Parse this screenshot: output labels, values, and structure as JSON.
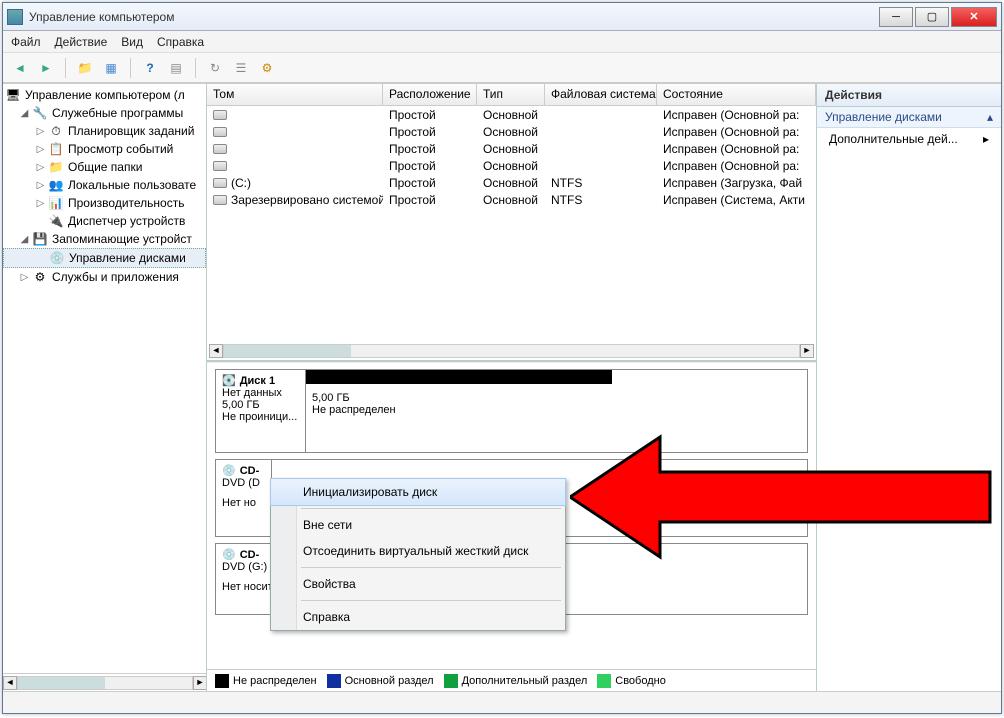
{
  "window": {
    "title": "Управление компьютером"
  },
  "menubar": [
    "Файл",
    "Действие",
    "Вид",
    "Справка"
  ],
  "tree": {
    "root": "Управление компьютером (л",
    "items": [
      {
        "label": "Служебные программы",
        "level": 1,
        "expanded": true,
        "children": [
          {
            "label": "Планировщик заданий"
          },
          {
            "label": "Просмотр событий"
          },
          {
            "label": "Общие папки"
          },
          {
            "label": "Локальные пользовате"
          },
          {
            "label": "Производительность"
          },
          {
            "label": "Диспетчер устройств"
          }
        ]
      },
      {
        "label": "Запоминающие устройст",
        "level": 1,
        "expanded": true,
        "children": [
          {
            "label": "Управление дисками",
            "selected": true
          }
        ]
      },
      {
        "label": "Службы и приложения",
        "level": 1,
        "expanded": false
      }
    ]
  },
  "volumes": {
    "columns": [
      "Том",
      "Расположение",
      "Тип",
      "Файловая система",
      "Состояние"
    ],
    "rows": [
      {
        "tom": "",
        "rasp": "Простой",
        "tip": "Основной",
        "fs": "",
        "state": "Исправен (Основной ра:"
      },
      {
        "tom": "",
        "rasp": "Простой",
        "tip": "Основной",
        "fs": "",
        "state": "Исправен (Основной ра:"
      },
      {
        "tom": "",
        "rasp": "Простой",
        "tip": "Основной",
        "fs": "",
        "state": "Исправен (Основной ра:"
      },
      {
        "tom": "",
        "rasp": "Простой",
        "tip": "Основной",
        "fs": "",
        "state": "Исправен (Основной ра:"
      },
      {
        "tom": "(C:)",
        "rasp": "Простой",
        "tip": "Основной",
        "fs": "NTFS",
        "state": "Исправен (Загрузка, Фай"
      },
      {
        "tom": "Зарезервировано системой",
        "rasp": "Простой",
        "tip": "Основной",
        "fs": "NTFS",
        "state": "Исправен (Система, Акти"
      }
    ]
  },
  "disks": {
    "disk1": {
      "name": "Диск 1",
      "status1": "Нет данных",
      "size": "5,00 ГБ",
      "status2": "Не проиници...",
      "part_size": "5,00 ГБ",
      "part_state": "Не распределен"
    },
    "cd1": {
      "name": "CD-",
      "drive": "DVD (D",
      "status": "Нет но"
    },
    "cd2": {
      "name": "CD-",
      "drive": "DVD (G:)",
      "status": "Нет носителя"
    }
  },
  "legend": [
    {
      "color": "#000000",
      "label": "Не распределен"
    },
    {
      "color": "#1030a0",
      "label": "Основной раздел"
    },
    {
      "color": "#10a040",
      "label": "Дополнительный раздел"
    },
    {
      "color": "#30d060",
      "label": "Свободно"
    }
  ],
  "actions": {
    "header": "Действия",
    "sub": "Управление дисками",
    "item1": "Дополнительные дей...",
    "arrow": "▸"
  },
  "context_menu": [
    {
      "label": "Инициализировать диск",
      "highlight": true
    },
    {
      "sep": true
    },
    {
      "label": "Вне сети"
    },
    {
      "label": "Отсоединить виртуальный жесткий диск"
    },
    {
      "sep": true
    },
    {
      "label": "Свойства"
    },
    {
      "sep": true
    },
    {
      "label": "Справка"
    }
  ]
}
